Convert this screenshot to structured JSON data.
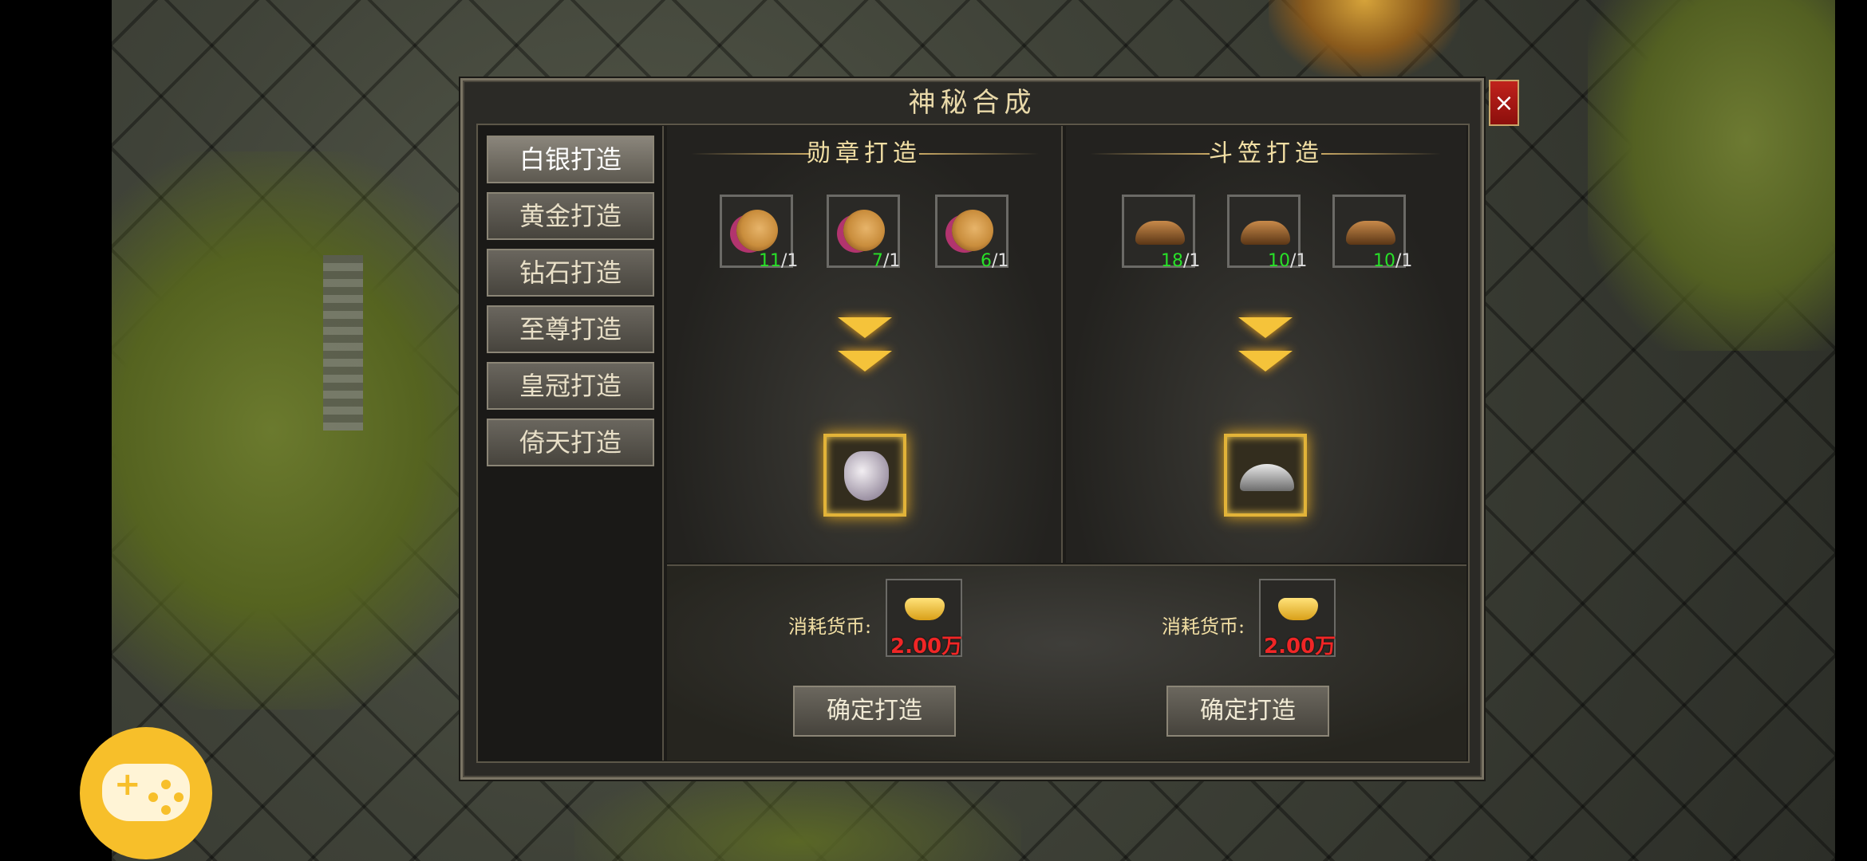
{
  "window": {
    "title": "神秘合成",
    "close_label": "×"
  },
  "sidebar": {
    "items": [
      {
        "label": "白银打造",
        "active": true
      },
      {
        "label": "黄金打造",
        "active": false
      },
      {
        "label": "钻石打造",
        "active": false
      },
      {
        "label": "至尊打造",
        "active": false
      },
      {
        "label": "皇冠打造",
        "active": false
      },
      {
        "label": "倚天打造",
        "active": false
      }
    ]
  },
  "crafts": [
    {
      "title": "勋章打造",
      "materials": [
        {
          "icon": "medal-icon",
          "have": "11",
          "need": "/1"
        },
        {
          "icon": "medal-icon",
          "have": "7",
          "need": "/1"
        },
        {
          "icon": "medal-icon",
          "have": "6",
          "need": "/1"
        }
      ],
      "result_icon": "mask-icon",
      "cost_label": "消耗货币:",
      "cost_icon": "gold-ingot-icon",
      "cost_value": "2.00万",
      "confirm_label": "确定打造"
    },
    {
      "title": "斗笠打造",
      "materials": [
        {
          "icon": "straw-hat-icon",
          "have": "18",
          "need": "/1"
        },
        {
          "icon": "straw-hat-icon",
          "have": "10",
          "need": "/1"
        },
        {
          "icon": "straw-hat-icon",
          "have": "10",
          "need": "/1"
        }
      ],
      "result_icon": "silver-hat-icon",
      "cost_label": "消耗货币:",
      "cost_icon": "gold-ingot-icon",
      "cost_value": "2.00万",
      "confirm_label": "确定打造"
    }
  ],
  "colors": {
    "accent_gold": "#f2dfa4",
    "count_green": "#28e028",
    "cost_red": "#f02626",
    "close_red": "#c0221c",
    "assistant_yellow": "#f7bf2a"
  },
  "overlay": {
    "game_assistant_icon": "gamepad-icon"
  }
}
